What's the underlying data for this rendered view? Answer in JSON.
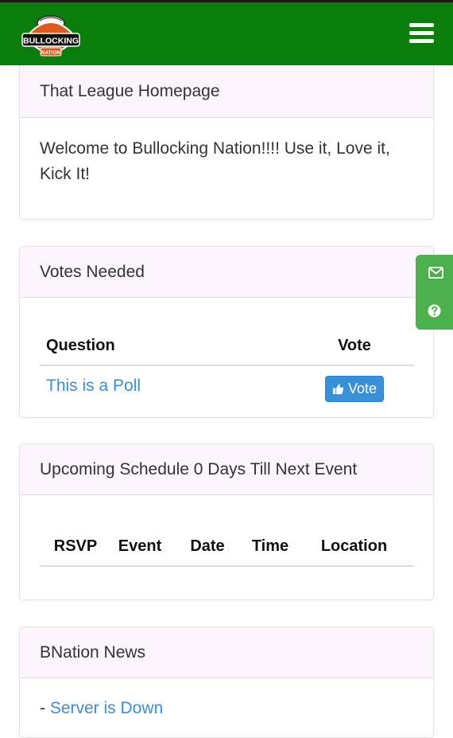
{
  "header": {
    "logo_text_top": "BULLOCKING",
    "logo_text_bottom": "NATION",
    "menu_icon": "hamburger-menu-icon"
  },
  "homepage": {
    "heading": "That League Homepage",
    "welcome": "Welcome to Bullocking Nation!!!! Use it, Love it, Kick It!"
  },
  "votes": {
    "heading": "Votes Needed",
    "columns": [
      "Question",
      "Vote"
    ],
    "rows": [
      {
        "question": "This is a Poll",
        "button": "Vote"
      }
    ]
  },
  "schedule": {
    "heading": "Upcoming Schedule 0 Days Till Next Event",
    "columns": [
      "RSVP",
      "Event",
      "Date",
      "Time",
      "Location"
    ]
  },
  "news": {
    "heading": "BNation News",
    "prefix": "- ",
    "items": [
      "Server is Down"
    ]
  },
  "side_tab": {
    "icons": [
      "envelope-icon",
      "question-circle-icon"
    ]
  },
  "colors": {
    "header_green": "#0b7d0b",
    "panel_heading_bg": "#fdf4fd",
    "link_blue": "#3a8dd6",
    "button_blue": "#3a8fd9",
    "side_tab_green": "#4cb04c"
  }
}
